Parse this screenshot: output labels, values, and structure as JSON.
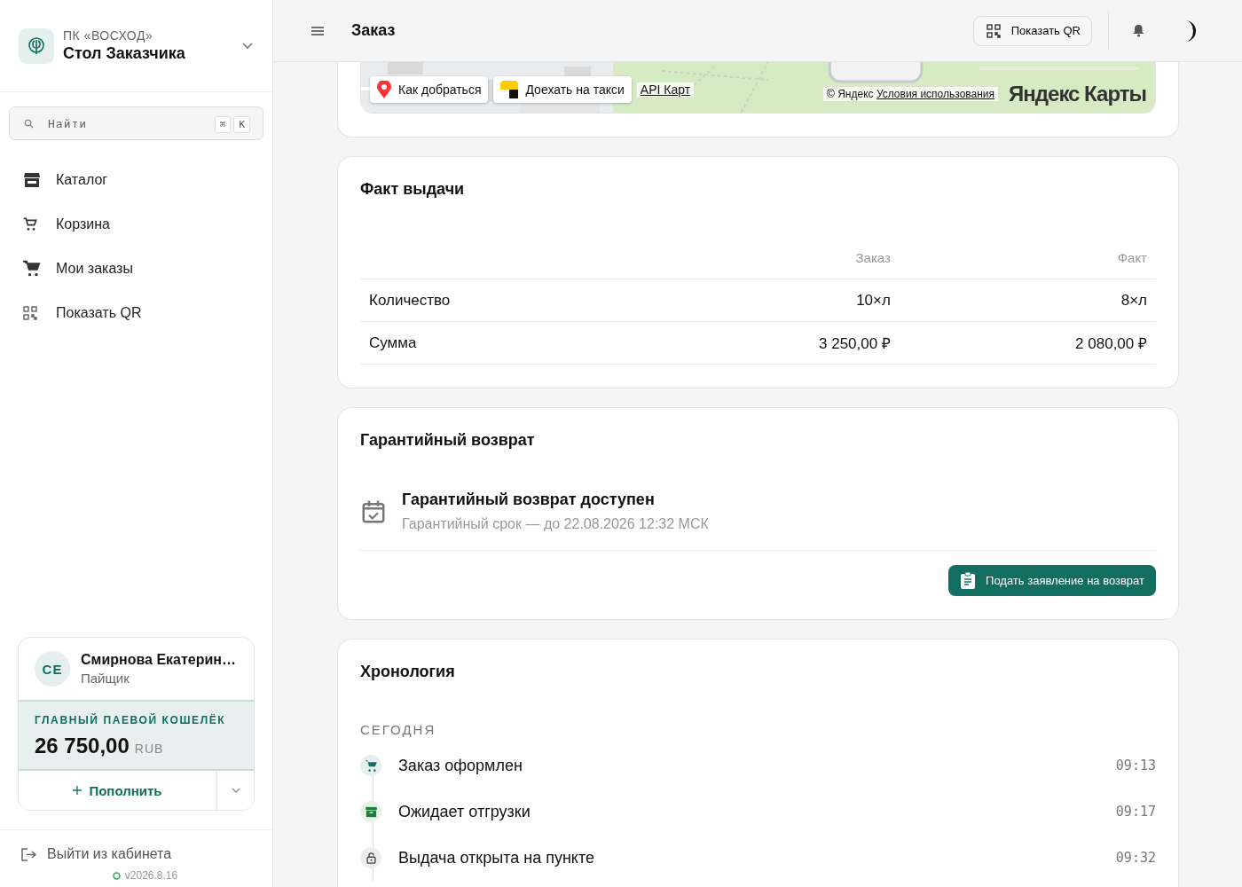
{
  "sidebar": {
    "org": "ПК «ВОСХОД»",
    "app_title": "Стол Заказчика",
    "search": {
      "placeholder": "Найти",
      "shortcut": [
        "⌘",
        "K"
      ]
    },
    "items": [
      {
        "label": "Каталог",
        "kind": "store",
        "selected": false
      },
      {
        "label": "Корзина",
        "kind": "cart-small",
        "selected": false
      },
      {
        "label": "Мои заказы",
        "kind": "cart",
        "selected": false
      },
      {
        "label": "Показать QR",
        "kind": "qr",
        "selected": false
      }
    ],
    "user": {
      "initials": "СЕ",
      "name": "Смирнова Екатерин…",
      "role": "Пайщик",
      "wallet_label": "ГЛАВНЫЙ ПАЕВОЙ КОШЕЛЁК",
      "balance": "26 750,00",
      "currency": "RUB",
      "topup": "Пополнить"
    },
    "logout": "Выйти из кабинета",
    "version": "v2026.8.16"
  },
  "header": {
    "title": "Заказ",
    "qr_button": "Показать QR"
  },
  "map": {
    "kind": "picture",
    "route_button": "Как добраться",
    "taxi_button": "Доехать на такси",
    "api_link": "API Карт",
    "copyright": "© Яндекс",
    "terms_link": "Условия использования",
    "logo": "Яндекс Карты"
  },
  "fact": {
    "title": "Факт выдачи",
    "columns": [
      "",
      "Заказ",
      "Факт"
    ],
    "rows": [
      [
        "Количество",
        "10×л",
        "8×л"
      ],
      [
        "Сумма",
        "3 250,00 ₽",
        "2 080,00 ₽"
      ]
    ]
  },
  "warranty": {
    "title": "Гарантийный возврат",
    "status": "Гарантийный возврат доступен",
    "term": "Гарантийный срок — до 22.08.2026 12:32 МСК",
    "button": "Подать заявление на возврат"
  },
  "timeline": {
    "title": "Хронология",
    "group": "СЕГОДНЯ",
    "events": [
      {
        "kind": "cart",
        "label": "Заказ оформлен",
        "time": "09:13"
      },
      {
        "kind": "box",
        "label": "Ожидает отгрузки",
        "time": "09:17"
      },
      {
        "kind": "lock",
        "label": "Выдача открыта на пункте",
        "time": "09:32"
      }
    ]
  }
}
